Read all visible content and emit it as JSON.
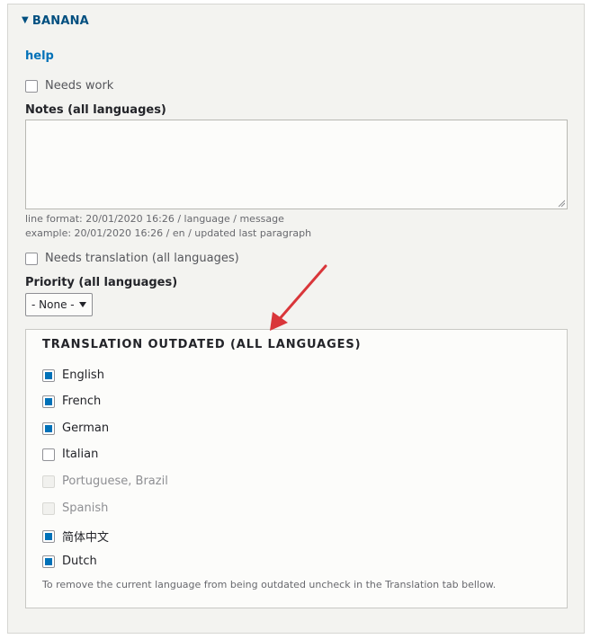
{
  "details": {
    "summary": "BANANA",
    "toggle_icon": "triangle-down-icon"
  },
  "help": {
    "label": "help"
  },
  "needs_work": {
    "label": "Needs work",
    "checked": false
  },
  "notes": {
    "label": "Notes (all languages)",
    "value": "",
    "description_line1": "line format: 20/01/2020 16:26 / language / message",
    "description_line2": "example: 20/01/2020 16:26 / en / updated last paragraph"
  },
  "needs_translation": {
    "label": "Needs translation (all languages)",
    "checked": false
  },
  "priority": {
    "label": "Priority (all languages)",
    "selected": "- None -"
  },
  "outdated": {
    "legend": "TRANSLATION OUTDATED (ALL LANGUAGES)",
    "languages": [
      {
        "label": "English",
        "checked": true,
        "disabled": false
      },
      {
        "label": "French",
        "checked": true,
        "disabled": false
      },
      {
        "label": "German",
        "checked": true,
        "disabled": false
      },
      {
        "label": "Italian",
        "checked": false,
        "disabled": false
      },
      {
        "label": "Portuguese, Brazil",
        "checked": false,
        "disabled": true
      },
      {
        "label": "Spanish",
        "checked": false,
        "disabled": true
      },
      {
        "label": "简体中文",
        "checked": true,
        "disabled": false
      },
      {
        "label": "Dutch",
        "checked": true,
        "disabled": false
      }
    ],
    "description": "To remove the current language from being outdated uncheck in the Translation tab bellow."
  },
  "colors": {
    "link": "#0071b8",
    "summary": "#004f80",
    "annotation_arrow": "#d9363a",
    "checkbox_fill": "#0071b8"
  }
}
